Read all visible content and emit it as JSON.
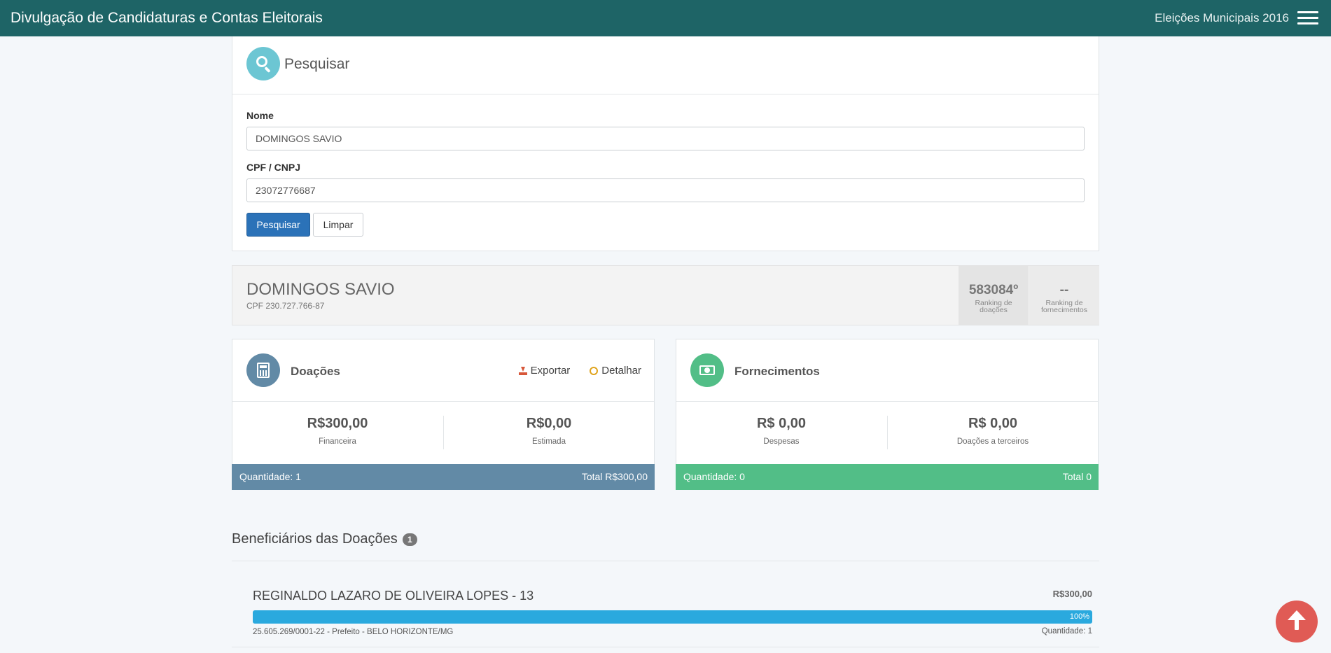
{
  "navbar": {
    "brand": "Divulgação de Candidaturas e Contas Eleitorais",
    "election": "Eleições Municipais 2016"
  },
  "search": {
    "title": "Pesquisar",
    "name_label": "Nome",
    "name_value": "DOMINGOS SAVIO",
    "cpf_label": "CPF / CNPJ",
    "cpf_value": "23072776687",
    "search_button": "Pesquisar",
    "clear_button": "Limpar"
  },
  "summary": {
    "name": "DOMINGOS SAVIO",
    "cpf": "CPF 230.727.766-87",
    "ranking_donations_value": "583084º",
    "ranking_donations_label": "Ranking de doações",
    "ranking_supplies_value": "--",
    "ranking_supplies_label": "Ranking de fornecimentos"
  },
  "donations": {
    "title": "Doações",
    "export_label": "Exportar",
    "detail_label": "Detalhar",
    "financial_value": "R$300,00",
    "financial_label": "Financeira",
    "estimated_value": "R$0,00",
    "estimated_label": "Estimada",
    "quantity": "Quantidade: 1",
    "total": "Total R$300,00",
    "color": "#628aa6",
    "icon": "calculator-icon"
  },
  "supplies": {
    "title": "Fornecimentos",
    "expenses_value": "R$ 0,00",
    "expenses_label": "Despesas",
    "third_party_value": "R$ 0,00",
    "third_party_label": "Doações a terceiros",
    "quantity": "Quantidade: 0",
    "total": "Total 0",
    "color": "#52be87",
    "icon": "money-icon"
  },
  "beneficiaries": {
    "title": "Beneficiários das Doações",
    "count": "1",
    "items": [
      {
        "name": "REGINALDO LAZARO DE OLIVEIRA LOPES - 13",
        "amount": "R$300,00",
        "percent": 100,
        "percent_label": "100%",
        "info": "25.605.269/0001-22 - Prefeito - BELO HORIZONTE/MG",
        "quantity": "Quantidade: 1"
      }
    ]
  }
}
